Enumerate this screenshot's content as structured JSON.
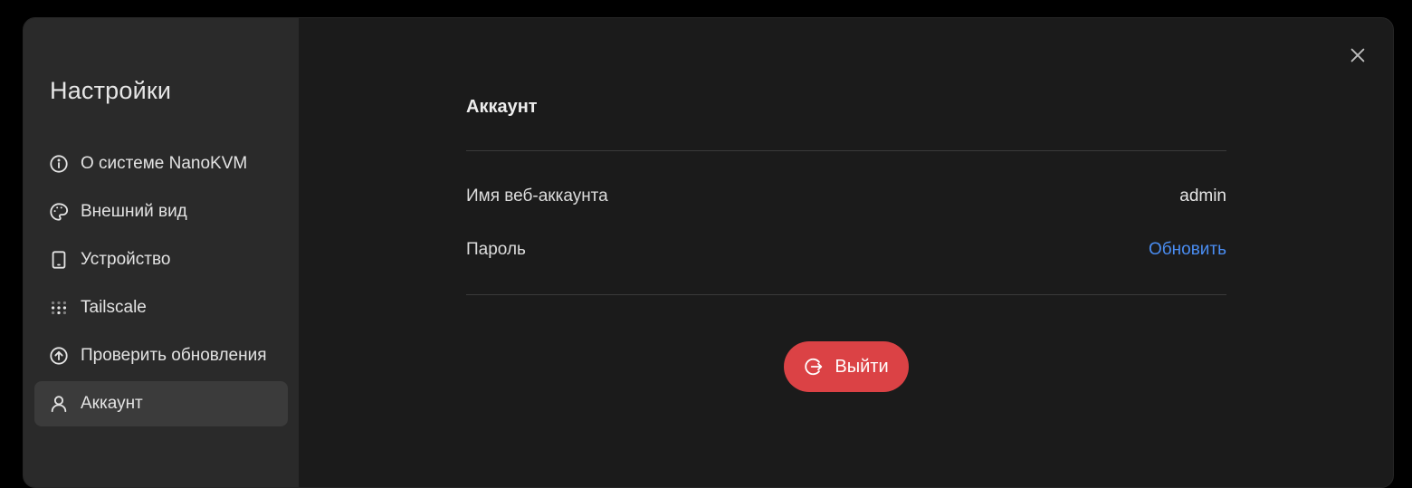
{
  "sidebar": {
    "title": "Настройки",
    "items": [
      {
        "label": "О системе NanoKVM",
        "icon": "info-circle-icon"
      },
      {
        "label": "Внешний вид",
        "icon": "palette-icon"
      },
      {
        "label": "Устройство",
        "icon": "tablet-icon"
      },
      {
        "label": "Tailscale",
        "icon": "tailscale-dots-icon"
      },
      {
        "label": "Проверить обновления",
        "icon": "arrow-up-circle-icon"
      },
      {
        "label": "Аккаунт",
        "icon": "user-icon",
        "active": true
      }
    ]
  },
  "account": {
    "title": "Аккаунт",
    "username_label": "Имя веб-аккаунта",
    "username_value": "admin",
    "password_label": "Пароль",
    "password_action": "Обновить",
    "logout_label": "Выйти"
  },
  "colors": {
    "accent_link": "#4a8df2",
    "logout_bg": "#db4245",
    "sidebar_bg": "#2a2a2a",
    "main_bg": "#1b1b1b"
  },
  "icons": {
    "close": "close-icon",
    "logout": "logout-icon"
  }
}
